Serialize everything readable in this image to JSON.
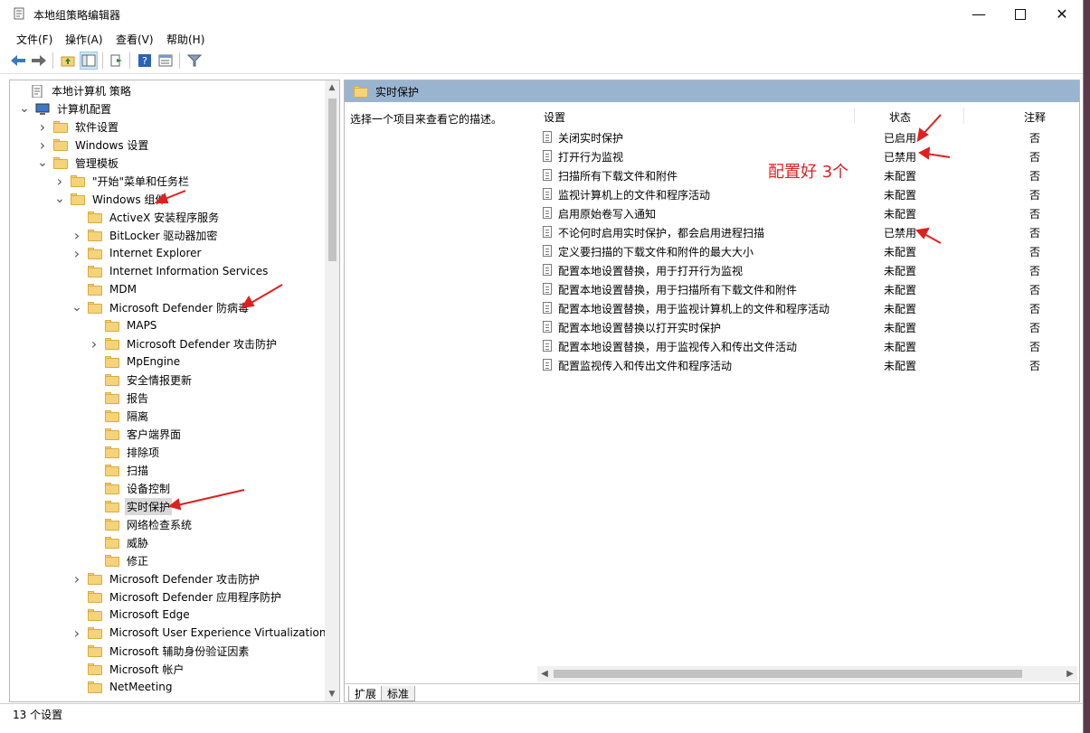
{
  "window": {
    "title": "本地组策略编辑器"
  },
  "menu": [
    "文件(F)",
    "操作(A)",
    "查看(V)",
    "帮助(H)"
  ],
  "tree": [
    {
      "label": "本地计算机 策略",
      "indent": 0,
      "chev": "",
      "icon": "doc"
    },
    {
      "label": "计算机配置",
      "indent": 1,
      "chev": "v",
      "icon": "computer"
    },
    {
      "label": "软件设置",
      "indent": 2,
      "chev": ">",
      "icon": "folder"
    },
    {
      "label": "Windows 设置",
      "indent": 2,
      "chev": ">",
      "icon": "folder"
    },
    {
      "label": "管理模板",
      "indent": 2,
      "chev": "v",
      "icon": "folder"
    },
    {
      "label": "\"开始\"菜单和任务栏",
      "indent": 3,
      "chev": ">",
      "icon": "folder"
    },
    {
      "label": "Windows 组件",
      "indent": 3,
      "chev": "v",
      "icon": "folder"
    },
    {
      "label": "ActiveX 安装程序服务",
      "indent": 4,
      "chev": "",
      "icon": "folder"
    },
    {
      "label": "BitLocker 驱动器加密",
      "indent": 4,
      "chev": ">",
      "icon": "folder"
    },
    {
      "label": "Internet Explorer",
      "indent": 4,
      "chev": ">",
      "icon": "folder"
    },
    {
      "label": "Internet Information Services",
      "indent": 4,
      "chev": "",
      "icon": "folder"
    },
    {
      "label": "MDM",
      "indent": 4,
      "chev": "",
      "icon": "folder"
    },
    {
      "label": "Microsoft Defender 防病毒",
      "indent": 4,
      "chev": "v",
      "icon": "folder"
    },
    {
      "label": "MAPS",
      "indent": 5,
      "chev": "",
      "icon": "folder"
    },
    {
      "label": "Microsoft Defender 攻击防护",
      "indent": 5,
      "chev": ">",
      "icon": "folder"
    },
    {
      "label": "MpEngine",
      "indent": 5,
      "chev": "",
      "icon": "folder"
    },
    {
      "label": "安全情报更新",
      "indent": 5,
      "chev": "",
      "icon": "folder"
    },
    {
      "label": "报告",
      "indent": 5,
      "chev": "",
      "icon": "folder"
    },
    {
      "label": "隔离",
      "indent": 5,
      "chev": "",
      "icon": "folder"
    },
    {
      "label": "客户端界面",
      "indent": 5,
      "chev": "",
      "icon": "folder"
    },
    {
      "label": "排除项",
      "indent": 5,
      "chev": "",
      "icon": "folder"
    },
    {
      "label": "扫描",
      "indent": 5,
      "chev": "",
      "icon": "folder"
    },
    {
      "label": "设备控制",
      "indent": 5,
      "chev": "",
      "icon": "folder"
    },
    {
      "label": "实时保护",
      "indent": 5,
      "chev": "",
      "icon": "folder",
      "selected": true
    },
    {
      "label": "网络检查系统",
      "indent": 5,
      "chev": "",
      "icon": "folder"
    },
    {
      "label": "威胁",
      "indent": 5,
      "chev": "",
      "icon": "folder"
    },
    {
      "label": "修正",
      "indent": 5,
      "chev": "",
      "icon": "folder"
    },
    {
      "label": "Microsoft Defender 攻击防护",
      "indent": 4,
      "chev": ">",
      "icon": "folder"
    },
    {
      "label": "Microsoft Defender 应用程序防护",
      "indent": 4,
      "chev": "",
      "icon": "folder"
    },
    {
      "label": "Microsoft Edge",
      "indent": 4,
      "chev": "",
      "icon": "folder"
    },
    {
      "label": "Microsoft User Experience Virtualization",
      "indent": 4,
      "chev": ">",
      "icon": "folder"
    },
    {
      "label": "Microsoft 辅助身份验证因素",
      "indent": 4,
      "chev": "",
      "icon": "folder"
    },
    {
      "label": "Microsoft 帐户",
      "indent": 4,
      "chev": "",
      "icon": "folder"
    },
    {
      "label": "NetMeeting",
      "indent": 4,
      "chev": "",
      "icon": "folder"
    }
  ],
  "right": {
    "header": "实时保护",
    "description": "选择一个项目来查看它的描述。",
    "columns": {
      "setting": "设置",
      "state": "状态",
      "note": "注释"
    },
    "rows": [
      {
        "name": "关闭实时保护",
        "state": "已启用",
        "note": "否"
      },
      {
        "name": "打开行为监视",
        "state": "已禁用",
        "note": "否"
      },
      {
        "name": "扫描所有下载文件和附件",
        "state": "未配置",
        "note": "否"
      },
      {
        "name": "监视计算机上的文件和程序活动",
        "state": "未配置",
        "note": "否"
      },
      {
        "name": "启用原始卷写入通知",
        "state": "未配置",
        "note": "否"
      },
      {
        "name": "不论何时启用实时保护，都会启用进程扫描",
        "state": "已禁用",
        "note": "否"
      },
      {
        "name": "定义要扫描的下载文件和附件的最大大小",
        "state": "未配置",
        "note": "否"
      },
      {
        "name": "配置本地设置替换，用于打开行为监视",
        "state": "未配置",
        "note": "否"
      },
      {
        "name": "配置本地设置替换，用于扫描所有下载文件和附件",
        "state": "未配置",
        "note": "否"
      },
      {
        "name": "配置本地设置替换，用于监视计算机上的文件和程序活动",
        "state": "未配置",
        "note": "否"
      },
      {
        "name": "配置本地设置替换以打开实时保护",
        "state": "未配置",
        "note": "否"
      },
      {
        "name": "配置本地设置替换，用于监视传入和传出文件活动",
        "state": "未配置",
        "note": "否"
      },
      {
        "name": "配置监视传入和传出文件和程序活动",
        "state": "未配置",
        "note": "否"
      }
    ],
    "tabs": [
      "扩展",
      "标准"
    ]
  },
  "status": "13 个设置",
  "annotation": "配置好 3个",
  "colors": {
    "header_blue": "#99b4d1",
    "annotation_red": "#e02020",
    "folder": "#f5d37a"
  }
}
